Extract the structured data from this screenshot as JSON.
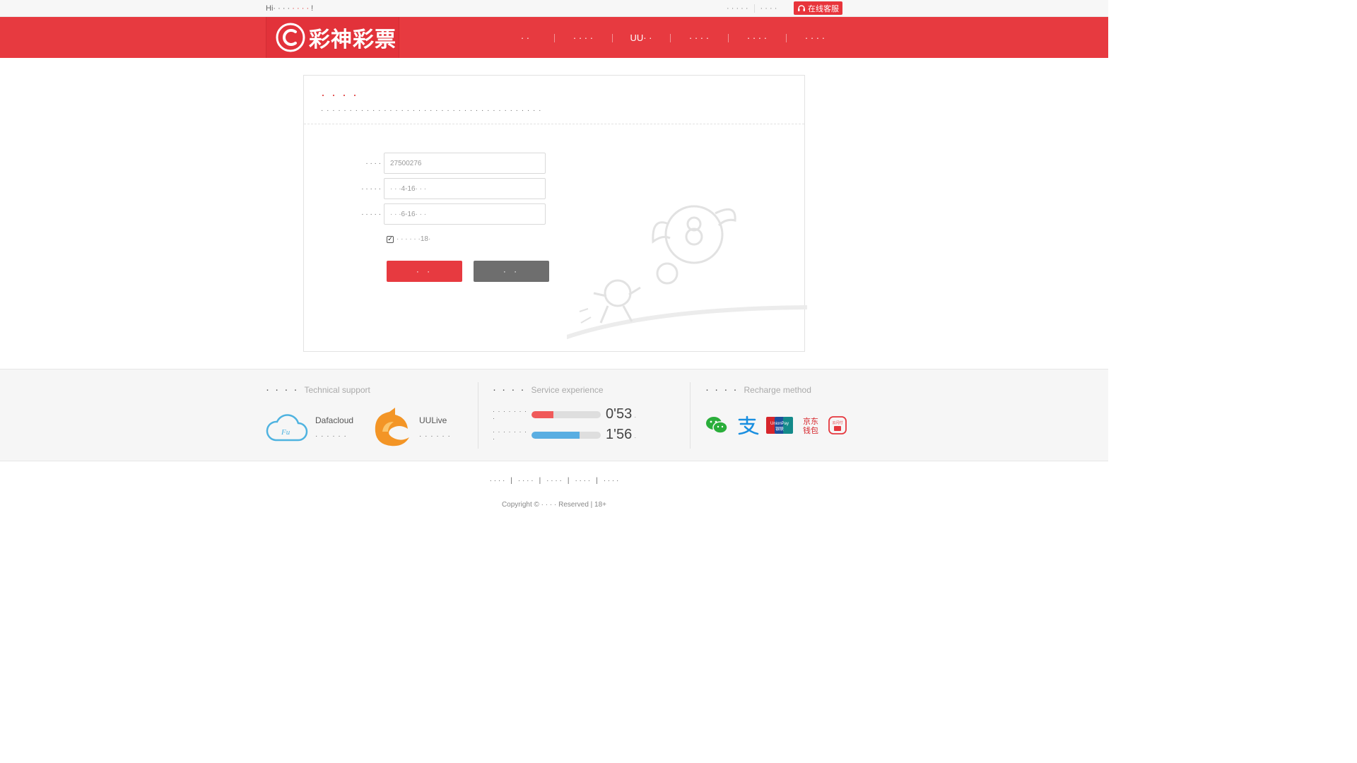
{
  "topbar": {
    "greeting_prefix": "Hi",
    "greeting_mid": "· · · ·",
    "greeting_link": "· · · ·",
    "greeting_suffix": "!",
    "links": [
      "· · · · ·",
      "· · · ·"
    ],
    "online_service": "在线客服"
  },
  "header": {
    "logo_text": "彩神彩票",
    "nav": [
      "· ·",
      "· · · ·",
      "UU· ·",
      "· · · ·",
      "· · · ·",
      "· · · ·"
    ]
  },
  "panel": {
    "title": "· · · ·",
    "subtitle": "· · · ·  · · · · · · · · · · · · · · · · · · · · · · · · · · · · · · · · · · ·",
    "fields": [
      {
        "label": "· · · ·",
        "value": "27500276"
      },
      {
        "label": "· · · · ·",
        "value": "· · ·4-16· · ·"
      },
      {
        "label": "· · · · ·",
        "value": "· · ·6-16· · ·"
      }
    ],
    "agree_text": "· · · · · ·18·",
    "agree_checked": true,
    "submit_label": "· ·",
    "reset_label": "· ·"
  },
  "info": {
    "tech": {
      "title_cn": "· · · ·",
      "title_en": "Technical support",
      "brands": [
        {
          "name": "Dafacloud",
          "caption": "· · · · · ·"
        },
        {
          "name": "UULive",
          "caption": "· · · · · ·"
        }
      ]
    },
    "service": {
      "title_cn": "· · · ·",
      "title_en": "Service experience",
      "rows": [
        {
          "label": "· · · · · · · ·",
          "value": "0'53",
          "unit": "·",
          "fill": 0.32,
          "color": "#f05a5a"
        },
        {
          "label": "· · · · · · · ·",
          "value": "1'56",
          "unit": "·",
          "fill": 0.69,
          "color": "#5aaee2"
        }
      ]
    },
    "recharge": {
      "title_cn": "· · · ·",
      "title_en": "Recharge method",
      "methods": [
        "wechat-pay-icon",
        "alipay-icon",
        "unionpay-icon",
        "jd-wallet-icon",
        "cloud-quickpass-icon"
      ]
    }
  },
  "footer": {
    "links": [
      "· · · ·",
      "· · · ·",
      "· · · ·",
      "· · · ·",
      "· · · ·"
    ],
    "copyright": "Copyright © · · · ·  Reserved | 18+"
  },
  "colors": {
    "brand_red": "#e73a40",
    "gray_button": "#6e6e6e"
  }
}
